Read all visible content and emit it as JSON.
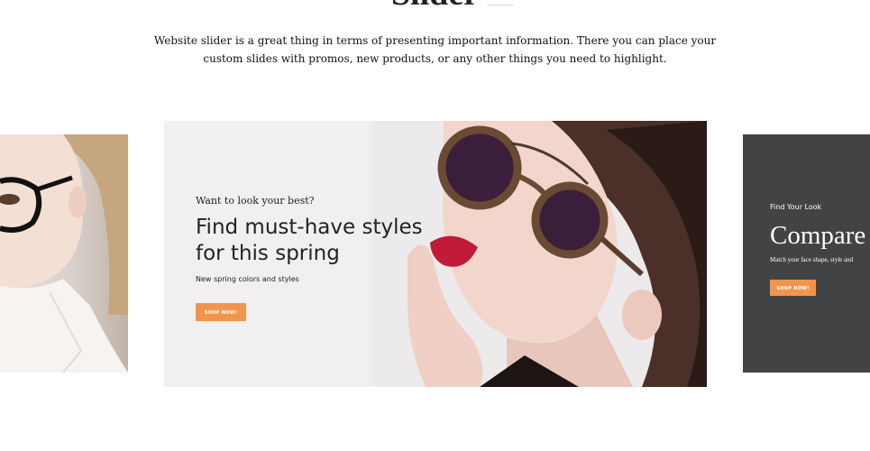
{
  "section": {
    "title": "Slider",
    "intro": "Website slider is a great thing in terms of presenting important information. There you can place your custom slides with promos, new products, or any other things you need to highlight."
  },
  "slides": [
    {
      "kicker": "Want to look your best?",
      "headline": "Find must-have styles for this spring",
      "subtext": "New spring colors and styles",
      "button": "SHOP NOW!"
    },
    {
      "kicker": "Find Your Look",
      "headline": "Compare",
      "subtext": "Match your face shape, style and",
      "button": "SHOP NOW!"
    }
  ],
  "colors": {
    "accent": "#f2954c",
    "dark_slide": "#414345",
    "main_slide_bg": "#f1efef"
  }
}
